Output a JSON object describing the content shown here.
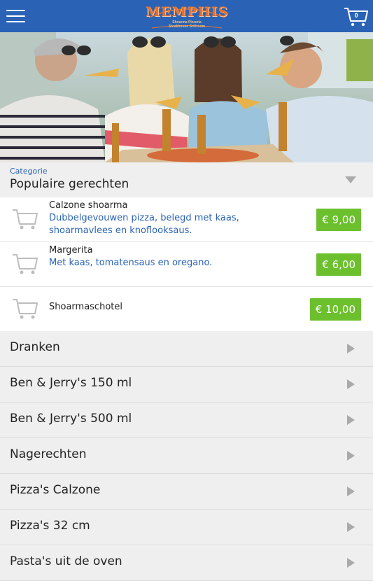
{
  "header": {
    "logo_text": "MEMPHIS",
    "logo_subtitle_1": "Shoarma Pizzeria",
    "logo_subtitle_2": "Steakhouse Grillroom",
    "cart_count": "0",
    "menu_icon": "hamburger-icon",
    "cart_icon": "shopping-cart-icon",
    "accent_color": "#2a63b5"
  },
  "category": {
    "label": "Categorie",
    "title": "Populaire gerechten"
  },
  "items": [
    {
      "name": "Calzone shoarma",
      "description": "Dubbelgevouwen pizza, belegd met kaas, shoarmavlees en knoflooksaus.",
      "price": "€ 9,00"
    },
    {
      "name": "Margerita",
      "description": "Met kaas, tomatensaus en oregano.",
      "price": "€ 6,00"
    },
    {
      "name": "Shoarmaschotel",
      "description": "",
      "price": "€ 10,00"
    }
  ],
  "price_color": "#6cc02e",
  "categories": [
    "Dranken",
    "Ben & Jerry's 150 ml",
    "Ben & Jerry's 500 ml",
    "Nagerechten",
    "Pizza's Calzone",
    "Pizza's 32 cm",
    "Pasta's uit de oven"
  ]
}
